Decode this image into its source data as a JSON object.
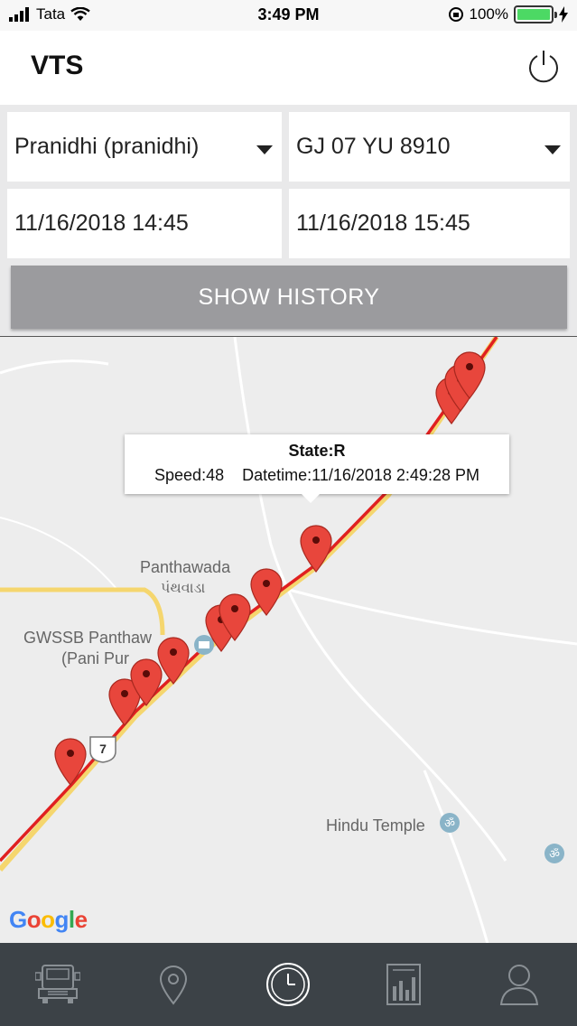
{
  "status_bar": {
    "carrier": "Tata",
    "time": "3:49 PM",
    "battery_percent": "100%",
    "battery_level": 1.0
  },
  "header": {
    "title": "VTS"
  },
  "filters": {
    "user_select": "Pranidhi (pranidhi)",
    "vehicle_select": "GJ 07 YU 8910",
    "start_datetime": "11/16/2018 14:45",
    "end_datetime": "11/16/2018 15:45",
    "show_history_label": "SHOW HISTORY"
  },
  "map": {
    "labels": {
      "place_en": "Panthawada",
      "place_gu": "પંથવાડા",
      "poi_line1": "GWSSB Panthaw",
      "poi_line2": "(Pani Pur",
      "temple": "Hindu Temple",
      "road_shield": "7"
    },
    "info_window": {
      "state": "State:R",
      "speed": "Speed:48",
      "datetime": "Datetime:11/16/2018 2:49:28 PM"
    },
    "attribution": "Google",
    "route_color": "#e02020",
    "marker_color": "#e8463c"
  },
  "bottom_nav": {
    "items": [
      "truck-icon",
      "location-pin-icon",
      "clock-icon",
      "report-icon",
      "profile-icon"
    ],
    "active": "clock-icon"
  }
}
